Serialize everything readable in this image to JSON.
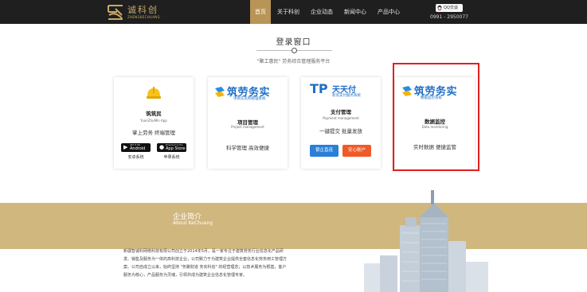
{
  "header": {
    "logo_cn": "诚科创",
    "logo_en": "ZHENGKECHUANG",
    "nav": [
      "首页",
      "关于科创",
      "企业动态",
      "新闻中心",
      "产品中心"
    ],
    "active_nav": 0,
    "qq_label": "QQ交谈",
    "phone": "0991 - 2950077"
  },
  "login": {
    "title": "登录窗口",
    "subtitle": "\"聚工惠民\" 劳务综合管理服务平台"
  },
  "cards": [
    {
      "title": "筑筑民",
      "subtitle": "YuanZhuMin App",
      "desc": "掌上劳务 终端管理",
      "stores": [
        {
          "small": "GET IT ON",
          "big": "Android",
          "caption": "安卓系统"
        },
        {
          "small": "Download on the",
          "big": "App Store",
          "caption": "苹果系统"
        }
      ]
    },
    {
      "brand": "筑劳务实",
      "brand_tag": "项目实名制管理系统",
      "title": "项目管理",
      "subtitle": "Project management",
      "desc": "科学管理 高效便捷"
    },
    {
      "brand_tp": "TP",
      "brand": "天天付",
      "brand_tag": "新资支付服务系统",
      "title": "支付管理",
      "subtitle": "Payment management",
      "desc": "一键提交 批量发放",
      "buttons": [
        "银企直连",
        "安心账户"
      ]
    },
    {
      "brand": "筑劳务实",
      "brand_tag": "数据监控系统",
      "title": "数据监控",
      "subtitle": "Data monitoring",
      "desc": "实时数据 便捷监管"
    }
  ],
  "about": {
    "title": "企业简介",
    "subtitle": "About KeChuang",
    "lines": [
      "新疆智诚科网络科技有限公司创立于2014年5月，是一家专注于建筑劳务行业信息化产品研",
      "发、销售及服务为一体的高科技企业，公司致力于为建筑企业提供全套信息化劳务用工管理方",
      "案。公司自成立以来，始终坚持 \"务聚财道 务实科创\" 的经营理念；以技术服务为根基，客户",
      "服务为核心，产品服务为灵魂，引领并成为建筑企业信息化管理专家。"
    ]
  },
  "colors": {
    "header_bg": "#1f1f1f",
    "gold": "#b89456",
    "banner": "#d0b77e",
    "brand_blue": "#1f6fc5",
    "button_blue": "#2a7fd6",
    "button_orange": "#f05a28",
    "highlight_red": "#e02020"
  }
}
